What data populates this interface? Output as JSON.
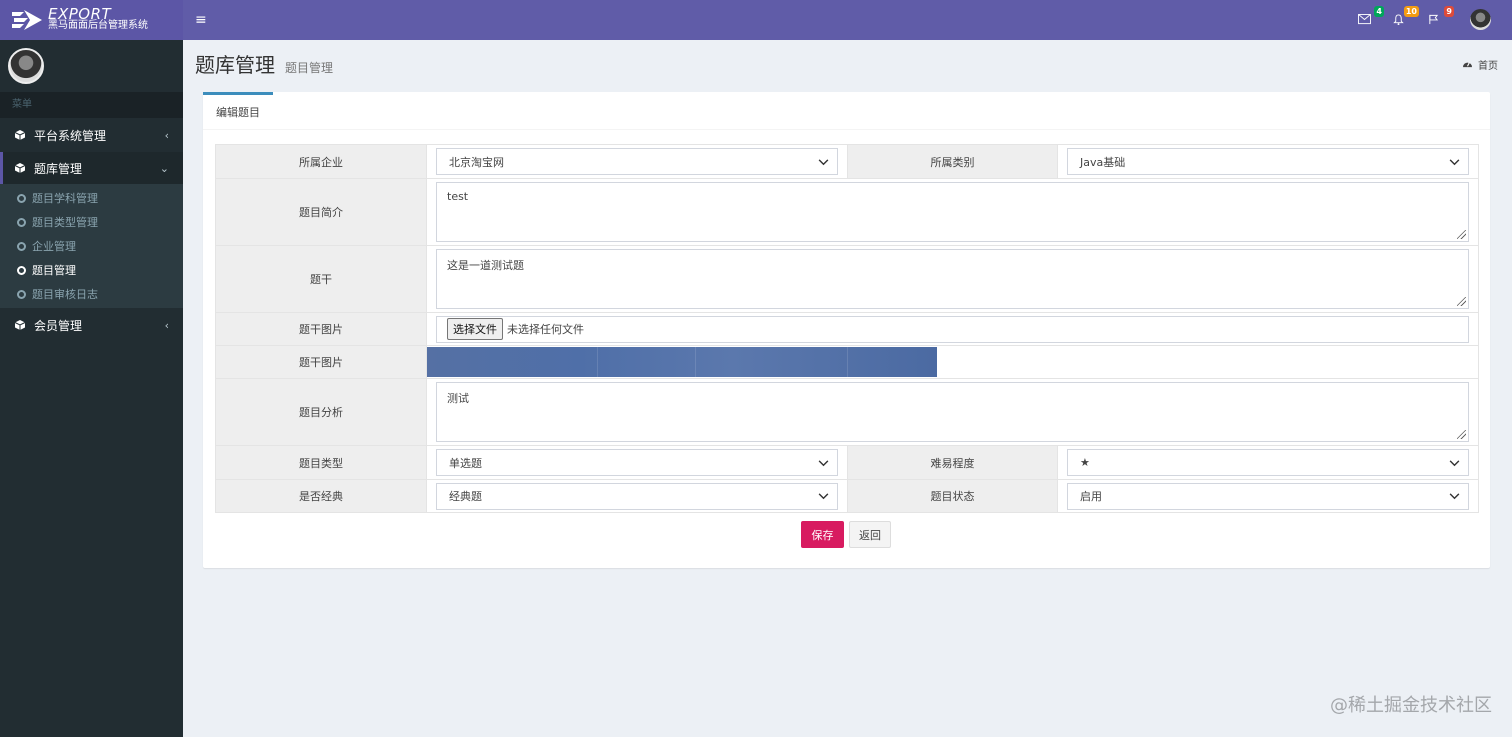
{
  "brand": {
    "title": "EXPORT",
    "subtitle": "黑马面面后台管理系统"
  },
  "sidebar": {
    "header": "菜单",
    "items": [
      {
        "label": "平台系统管理",
        "chevron": "‹"
      },
      {
        "label": "题库管理",
        "chevron": "⌄"
      },
      {
        "label": "会员管理",
        "chevron": "‹"
      }
    ],
    "subitems": [
      "题目学科管理",
      "题目类型管理",
      "企业管理",
      "题目管理",
      "题目审核日志"
    ]
  },
  "topbar": {
    "menu_icon": "≡",
    "notifications": [
      {
        "icon": "envelope-icon",
        "count": "4",
        "color": "#00a65a"
      },
      {
        "icon": "bell-icon",
        "count": "10",
        "color": "#f39c12"
      },
      {
        "icon": "flag-icon",
        "count": "9",
        "color": "#dd4b39"
      }
    ]
  },
  "header": {
    "title": "题库管理",
    "subtitle": "题目管理",
    "breadcrumb": "首页"
  },
  "tab": {
    "label": "编辑题目"
  },
  "form": {
    "company_label": "所属企业",
    "company_value": "北京淘宝网",
    "category_label": "所属类别",
    "category_value": "Java基础",
    "intro_label": "题目简介",
    "intro_value": "test",
    "stem_label": "题干",
    "stem_value": "这是一道测试题",
    "stem_image_label": "题干图片",
    "file_button": "选择文件",
    "file_status": "未选择任何文件",
    "stem_image_preview_label": "题干图片",
    "analysis_label": "题目分析",
    "analysis_value": "测试",
    "type_label": "题目类型",
    "type_value": "单选题",
    "difficulty_label": "难易程度",
    "difficulty_value": "★",
    "classic_label": "是否经典",
    "classic_value": "经典题",
    "status_label": "题目状态",
    "status_value": "启用"
  },
  "buttons": {
    "save": "保存",
    "back": "返回"
  },
  "watermark": "@稀土掘金技术社区"
}
